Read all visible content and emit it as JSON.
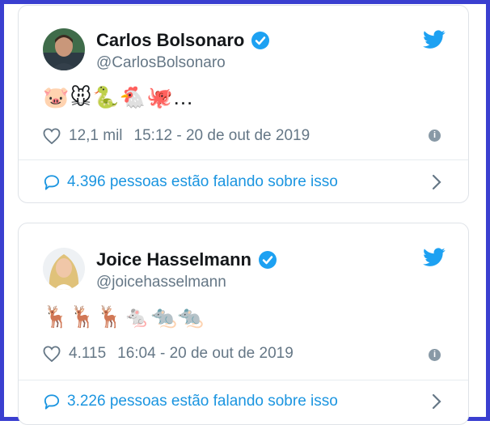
{
  "colors": {
    "border": "#3a3fd0",
    "twitter_blue": "#1da1f2",
    "link": "#1b95e0",
    "muted": "#657786"
  },
  "tweets": [
    {
      "name": "Carlos Bolsonaro",
      "handle": "@CarlosBolsonaro",
      "emojis": "🐷🐭🐍🐔🐙...",
      "likes": "12,1 mil",
      "timestamp": "15:12 - 20 de out de 2019",
      "talking": "4.396 pessoas estão falando sobre isso",
      "icons": [
        "verified-badge-icon",
        "twitter-bird-icon",
        "heart-icon",
        "info-icon",
        "speech-bubble-icon",
        "chevron-right-icon"
      ]
    },
    {
      "name": "Joice Hasselmann",
      "handle": "@joicehasselmann",
      "emojis": "🦌🦌🦌🐁🐀🐀",
      "likes": "4.115",
      "timestamp": "16:04 - 20 de out de 2019",
      "talking": "3.226 pessoas estão falando sobre isso",
      "icons": [
        "verified-badge-icon",
        "twitter-bird-icon",
        "heart-icon",
        "info-icon",
        "speech-bubble-icon",
        "chevron-right-icon"
      ]
    }
  ]
}
